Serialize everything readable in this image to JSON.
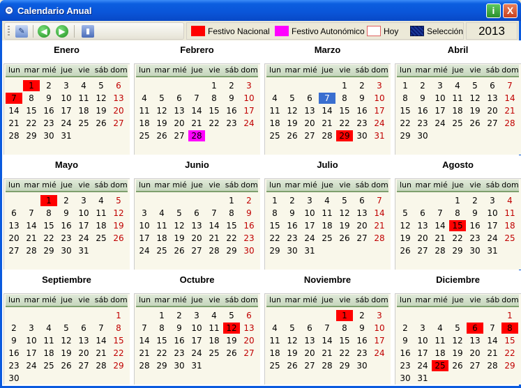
{
  "window": {
    "title": "Calendario Anual",
    "info_label": "i",
    "close_label": "X"
  },
  "toolbar": {
    "edit_icon": "edit-icon",
    "prev_icon": "prev-year-icon",
    "next_icon": "next-year-icon",
    "exit_icon": "exit-icon"
  },
  "legend": {
    "nacional": "Festivo Nacional",
    "autonomico": "Festivo Autonómico",
    "hoy": "Hoy",
    "seleccion": "Selección",
    "colors": {
      "nacional": "#ff0000",
      "autonomico": "#ff00ff",
      "seleccion": "#3a6fd0"
    }
  },
  "year": "2013",
  "weekdays": [
    "lun",
    "mar",
    "mié",
    "jue",
    "vie",
    "sáb",
    "dom"
  ],
  "months": [
    {
      "name": "Enero",
      "offset": 1,
      "days": 31,
      "nacional": [
        1,
        7
      ],
      "autonomico": [],
      "selected": []
    },
    {
      "name": "Febrero",
      "offset": 4,
      "days": 28,
      "nacional": [],
      "autonomico": [
        28
      ],
      "selected": []
    },
    {
      "name": "Marzo",
      "offset": 4,
      "days": 31,
      "nacional": [
        29
      ],
      "autonomico": [],
      "selected": [
        7
      ]
    },
    {
      "name": "Abril",
      "offset": 0,
      "days": 30,
      "nacional": [],
      "autonomico": [],
      "selected": []
    },
    {
      "name": "Mayo",
      "offset": 2,
      "days": 31,
      "nacional": [
        1
      ],
      "autonomico": [],
      "selected": []
    },
    {
      "name": "Junio",
      "offset": 5,
      "days": 30,
      "nacional": [],
      "autonomico": [],
      "selected": []
    },
    {
      "name": "Julio",
      "offset": 0,
      "days": 31,
      "nacional": [],
      "autonomico": [],
      "selected": []
    },
    {
      "name": "Agosto",
      "offset": 3,
      "days": 31,
      "nacional": [
        15
      ],
      "autonomico": [],
      "selected": []
    },
    {
      "name": "Septiembre",
      "offset": 6,
      "days": 30,
      "nacional": [],
      "autonomico": [],
      "selected": []
    },
    {
      "name": "Octubre",
      "offset": 1,
      "days": 31,
      "nacional": [
        12
      ],
      "autonomico": [],
      "selected": []
    },
    {
      "name": "Noviembre",
      "offset": 4,
      "days": 30,
      "nacional": [
        1
      ],
      "autonomico": [],
      "selected": []
    },
    {
      "name": "Diciembre",
      "offset": 6,
      "days": 31,
      "nacional": [
        6,
        8,
        25
      ],
      "autonomico": [],
      "selected": []
    }
  ]
}
